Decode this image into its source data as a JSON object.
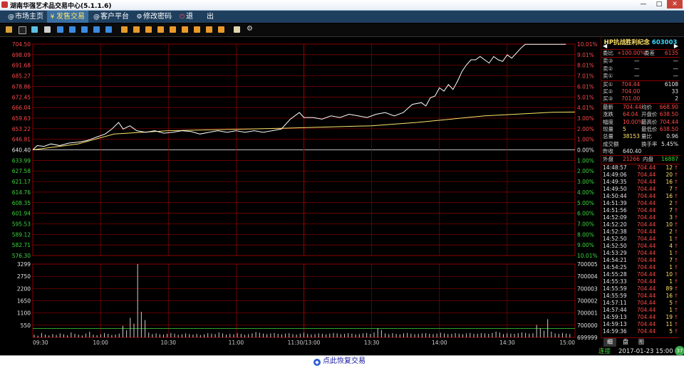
{
  "window": {
    "title": "湖南华强艺术品交易中心(5.1.1.6)",
    "min_label": "—",
    "max_label": "□",
    "close_label": "✕"
  },
  "menu": [
    {
      "label": "市场主页",
      "icon": "@"
    },
    {
      "label": "发售交易",
      "icon": "¥"
    },
    {
      "label": "客户平台",
      "icon": "@"
    },
    {
      "label": "修改密码",
      "icon": "⚙"
    },
    {
      "label": "退",
      "icon": "⏻"
    },
    {
      "label": "出",
      "icon": ""
    }
  ],
  "toolbar_icons": [
    "bar-chart-icon",
    "line-chart-icon",
    "candle-icon",
    "list-icon",
    "grid-icon",
    "f1-icon",
    "f2-icon",
    "f3-icon",
    "f4-icon",
    "f5-icon",
    "f6-icon",
    "f7-icon",
    "f8-icon",
    "f9-icon",
    "f10-icon",
    "f11-icon",
    "f12-icon",
    "f13-icon",
    "f14-icon",
    "edit-icon",
    "settings-icon"
  ],
  "colors": {
    "up": "#ff4848",
    "down": "#3dd63d",
    "grid": "#8b0000",
    "price_line": "#ffffff",
    "avg_line": "#ffe56a",
    "volume": "#cfcfcf",
    "base": "#3dd63d"
  },
  "chart_data": {
    "type": "line",
    "title": "",
    "base_price": "640.40",
    "price_ticks": [
      "704.50",
      "698.09",
      "691.68",
      "685.27",
      "678.86",
      "672.45",
      "666.04",
      "659.63",
      "653.22",
      "646.81",
      "640.40",
      "633.99",
      "627.58",
      "621.17",
      "614.76",
      "608.35",
      "601.94",
      "595.53",
      "589.12",
      "582.71",
      "576.30"
    ],
    "pct_ticks": [
      "10.01%",
      "9.01%",
      "8.01%",
      "7.01%",
      "6.01%",
      "5.01%",
      "4.01%",
      "3.00%",
      "2.00%",
      "1.00%",
      "0.00%",
      "1.00%",
      "2.00%",
      "3.00%",
      "4.00%",
      "5.00%",
      "6.00%",
      "7.00%",
      "8.00%",
      "9.00%",
      "10.01%"
    ],
    "volume_ticks": [
      "3299",
      "2750",
      "2200",
      "1650",
      "1100",
      "550"
    ],
    "amount_ticks": [
      "700005",
      "700004",
      "700003",
      "700002",
      "700001",
      "700000",
      "699999"
    ],
    "time_ticks": [
      "09:30",
      "10:00",
      "10:30",
      "11:00",
      "11:30/13:00",
      "13:30",
      "14:00",
      "14:30",
      "15:00"
    ],
    "ylim": [
      576.3,
      704.5
    ],
    "price_series": [
      [
        0,
        640.4
      ],
      [
        2,
        643
      ],
      [
        5,
        642.5
      ],
      [
        8,
        644
      ],
      [
        12,
        643
      ],
      [
        16,
        644.5
      ],
      [
        20,
        645
      ],
      [
        24,
        646
      ],
      [
        28,
        648
      ],
      [
        32,
        650
      ],
      [
        35,
        653
      ],
      [
        38,
        657
      ],
      [
        40,
        653
      ],
      [
        43,
        655
      ],
      [
        46,
        652
      ],
      [
        50,
        651
      ],
      [
        54,
        652
      ],
      [
        58,
        650.5
      ],
      [
        62,
        651
      ],
      [
        66,
        652
      ],
      [
        70,
        651.5
      ],
      [
        74,
        650
      ],
      [
        78,
        651
      ],
      [
        82,
        652
      ],
      [
        86,
        651
      ],
      [
        90,
        652
      ],
      [
        94,
        651
      ],
      [
        98,
        652
      ],
      [
        102,
        651
      ],
      [
        106,
        652
      ],
      [
        110,
        653
      ],
      [
        114,
        659
      ],
      [
        118,
        663
      ],
      [
        120,
        660
      ],
      [
        124,
        660
      ],
      [
        128,
        659
      ],
      [
        132,
        661
      ],
      [
        136,
        660
      ],
      [
        140,
        662
      ],
      [
        144,
        661
      ],
      [
        148,
        660
      ],
      [
        152,
        662
      ],
      [
        156,
        663
      ],
      [
        160,
        661
      ],
      [
        164,
        663
      ],
      [
        168,
        668
      ],
      [
        172,
        669
      ],
      [
        174,
        667
      ],
      [
        176,
        672
      ],
      [
        178,
        673
      ],
      [
        180,
        678
      ],
      [
        182,
        676
      ],
      [
        184,
        680
      ],
      [
        186,
        677
      ],
      [
        188,
        682
      ],
      [
        190,
        688
      ],
      [
        192,
        692
      ],
      [
        194,
        695
      ],
      [
        196,
        695
      ],
      [
        198,
        697
      ],
      [
        200,
        695
      ],
      [
        202,
        693
      ],
      [
        204,
        697
      ],
      [
        206,
        695
      ],
      [
        208,
        694
      ],
      [
        210,
        698
      ],
      [
        212,
        696
      ],
      [
        214,
        699
      ],
      [
        216,
        702
      ],
      [
        218,
        704.4
      ],
      [
        236,
        704.4
      ]
    ],
    "avg_series": [
      [
        0,
        640.4
      ],
      [
        20,
        644
      ],
      [
        36,
        650
      ],
      [
        60,
        652
      ],
      [
        110,
        653.5
      ],
      [
        150,
        655
      ],
      [
        170,
        657
      ],
      [
        200,
        661
      ],
      [
        230,
        663.2
      ],
      [
        240,
        663.3
      ]
    ],
    "volume_series": [
      120,
      80,
      200,
      130,
      90,
      150,
      110,
      180,
      140,
      100,
      220,
      160,
      130,
      90,
      170,
      250,
      120,
      100,
      140,
      190,
      160,
      110,
      130,
      170,
      520,
      320,
      880,
      620,
      3299,
      1150,
      780,
      220,
      150,
      180,
      140,
      130,
      160,
      200,
      170,
      120,
      140,
      180,
      150,
      130,
      160,
      110,
      140,
      190,
      170,
      150,
      220,
      180,
      130,
      160,
      140,
      190,
      160,
      120,
      150,
      180,
      240,
      210,
      170,
      150,
      180,
      200,
      160,
      140,
      170,
      190,
      150,
      130,
      170,
      210,
      160,
      140,
      150,
      180,
      160,
      140,
      170,
      200,
      180,
      150,
      160,
      190,
      170,
      140,
      150,
      180,
      200,
      160,
      220,
      410,
      330,
      180,
      150,
      190,
      160,
      140,
      180,
      200,
      170,
      150,
      160,
      180,
      190,
      160,
      150,
      170,
      210,
      180,
      150,
      160,
      190,
      170,
      150,
      180,
      200,
      160,
      170,
      190,
      180,
      160,
      200,
      260,
      220,
      150,
      180,
      170,
      160,
      190,
      220,
      200,
      170,
      190,
      560,
      420,
      300,
      820,
      260,
      180,
      160,
      200,
      170,
      150
    ]
  },
  "stock": {
    "name": "HP抗战胜利纪念",
    "code": "603003"
  },
  "order_book": {
    "weibi_label": "委比",
    "weibi_value": "+100.00%",
    "weicha_label": "委差",
    "weicha_value": "6135",
    "sell": [
      {
        "label": "卖③",
        "price": "—",
        "vol": "—"
      },
      {
        "label": "卖②",
        "price": "—",
        "vol": "—"
      },
      {
        "label": "卖①",
        "price": "—",
        "vol": "—"
      }
    ],
    "buy": [
      {
        "label": "买①",
        "price": "704.44",
        "vol": "6108"
      },
      {
        "label": "买②",
        "price": "704.00",
        "vol": "33"
      },
      {
        "label": "买③",
        "price": "701.00",
        "vol": "2"
      }
    ]
  },
  "quote": {
    "last_label": "最新",
    "last": "704.44",
    "avg_label": "均价",
    "avg": "668.90",
    "chg_label": "涨跌",
    "chg": "64.04",
    "open_label": "开盘价",
    "open": "638.50",
    "pct_label": "幅度",
    "pct": "10.00%",
    "high_label": "最高价",
    "high": "704.44",
    "vol_label": "现量",
    "vol": "5",
    "low_label": "最低价",
    "low": "638.50",
    "total_label": "总量",
    "total": "38153",
    "ratio_label": "量比",
    "ratio": "0.96",
    "amount_label": "成交额",
    "amount": "",
    "turn_label": "换手率",
    "turn": "5.45%",
    "prev_label": "昨收",
    "prev": "640.40",
    "outer_label": "外盘",
    "outer": "21266",
    "inner_label": "内盘",
    "inner": "16887"
  },
  "ticks": [
    {
      "t": "14:48:57",
      "p": "704.44",
      "v": "12",
      "d": "↑"
    },
    {
      "t": "14:49:06",
      "p": "704.44",
      "v": "20",
      "d": "↑"
    },
    {
      "t": "14:49:35",
      "p": "704.44",
      "v": "16",
      "d": "↑"
    },
    {
      "t": "14:49:50",
      "p": "704.44",
      "v": "7",
      "d": "↑"
    },
    {
      "t": "14:50:44",
      "p": "704.44",
      "v": "16",
      "d": "↑"
    },
    {
      "t": "14:51:39",
      "p": "704.44",
      "v": "2",
      "d": "↑"
    },
    {
      "t": "14:51:56",
      "p": "704.44",
      "v": "7",
      "d": "↑"
    },
    {
      "t": "14:52:09",
      "p": "704.44",
      "v": "3",
      "d": "↑"
    },
    {
      "t": "14:52:20",
      "p": "704.44",
      "v": "10",
      "d": "↑"
    },
    {
      "t": "14:52:38",
      "p": "704.44",
      "v": "2",
      "d": "↑"
    },
    {
      "t": "14:52:50",
      "p": "704.44",
      "v": "1",
      "d": "↑"
    },
    {
      "t": "14:52:50",
      "p": "704.44",
      "v": "4",
      "d": "↑"
    },
    {
      "t": "14:53:29",
      "p": "704.44",
      "v": "1",
      "d": "↑"
    },
    {
      "t": "14:54:21",
      "p": "704.44",
      "v": "7",
      "d": "↑"
    },
    {
      "t": "14:54:25",
      "p": "704.44",
      "v": "1",
      "d": "↑"
    },
    {
      "t": "14:55:28",
      "p": "704.44",
      "v": "10",
      "d": "↑"
    },
    {
      "t": "14:55:33",
      "p": "704.44",
      "v": "1",
      "d": "↑"
    },
    {
      "t": "14:55:59",
      "p": "704.44",
      "v": "89",
      "d": "↑"
    },
    {
      "t": "14:55:59",
      "p": "704.44",
      "v": "16",
      "d": "↑"
    },
    {
      "t": "14:57:11",
      "p": "704.44",
      "v": "5",
      "d": "↑"
    },
    {
      "t": "14:57:44",
      "p": "704.44",
      "v": "1",
      "d": "↑"
    },
    {
      "t": "14:59:13",
      "p": "704.44",
      "v": "19",
      "d": "↑"
    },
    {
      "t": "14:59:13",
      "p": "704.44",
      "v": "11",
      "d": "↑"
    },
    {
      "t": "14:59:36",
      "p": "704.44",
      "v": "5",
      "d": "↑"
    }
  ],
  "side_tabs": [
    "细",
    "盘",
    "图"
  ],
  "status": {
    "conn": "连接",
    "datetime": "2017-01-23 15:00"
  },
  "bottom": {
    "resume": "点此恢复交易",
    "badge": "37"
  }
}
